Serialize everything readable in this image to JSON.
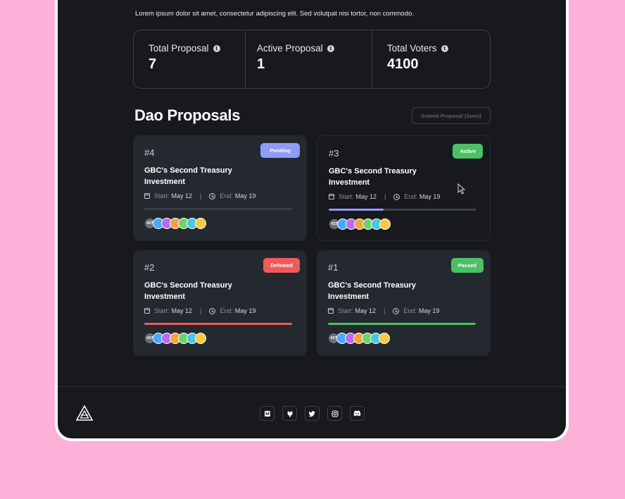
{
  "header": {
    "subtitle": "Lorem ipsum dolor sit amet, consectetur adipiscing elit. Sed volutpat nisi tortor, non commodo."
  },
  "stats": [
    {
      "label": "Total Proposal",
      "value": "7"
    },
    {
      "label": "Active Proposal",
      "value": "1"
    },
    {
      "label": "Total Voters",
      "value": "4100"
    }
  ],
  "proposals_section": {
    "title": "Dao Proposals",
    "submit_label": "Submit Proposal (Soon)"
  },
  "proposals": [
    {
      "number": "#4",
      "status": "Pending",
      "status_color": "#8e9bfa",
      "title": "GBC's Second Treasury Investment",
      "start_label": "Start:",
      "start": "May 12",
      "end_label": "End:",
      "end": "May 19",
      "progress": 0,
      "progress_color": "#3a4047",
      "voter_count": "427"
    },
    {
      "number": "#3",
      "status": "Active",
      "status_color": "#4cc065",
      "title": "GBC's Second Treasury Investment",
      "start_label": "Start:",
      "start": "May 12",
      "end_label": "End:",
      "end": "May 19",
      "progress": 0.37,
      "progress_color": "#8e9bfa",
      "voter_count": "427"
    },
    {
      "number": "#2",
      "status": "Defeated",
      "status_color": "#f05a5a",
      "title": "GBC's Second Treasury Investment",
      "start_label": "Start:",
      "start": "May 12",
      "end_label": "End:",
      "end": "May 19",
      "progress": 1,
      "progress_color": "#f05a5a",
      "voter_count": "427"
    },
    {
      "number": "#1",
      "status": "Passed",
      "status_color": "#4cc065",
      "title": "GBC's Second Treasury Investment",
      "start_label": "Start:",
      "start": "May 12",
      "end_label": "End:",
      "end": "May 19",
      "progress": 1,
      "progress_color": "#4cc065",
      "voter_count": "427"
    }
  ],
  "avatar_colors": [
    "#4aa8ff",
    "#b86cf0",
    "#f4a340",
    "#6dd46b",
    "#49c7e0",
    "#f6c944"
  ],
  "footer": {
    "socials": [
      "medium-icon",
      "github-icon",
      "twitter-icon",
      "instagram-icon",
      "discord-icon"
    ]
  }
}
